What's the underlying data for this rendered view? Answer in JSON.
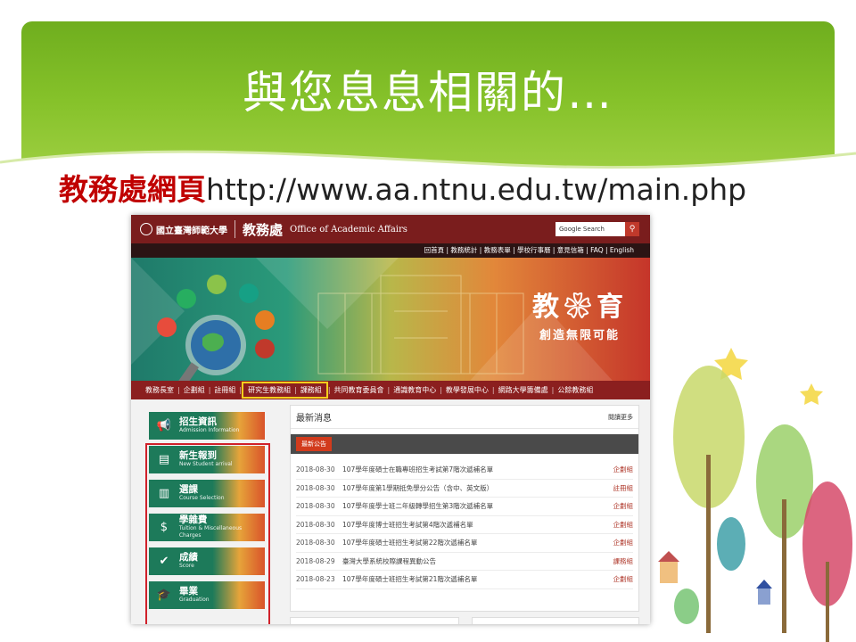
{
  "slide": {
    "title": "與您息息相關的…",
    "subtitle_red": "教務處網頁",
    "subtitle_url": "http://www.aa.ntnu.edu.tw/main.php"
  },
  "site": {
    "logo_text": "國立臺灣師範大學",
    "dept_zh": "教務處",
    "dept_en": "Office of Academic Affairs",
    "search_placeholder": "Google Search",
    "utility_links": "回首頁 | 教務統計 | 教務表單 | 學校行事曆 | 意見信箱 | FAQ | English",
    "hero_big": "教❀育",
    "hero_slogan": "創造無限可能",
    "nav": [
      "教務長室",
      "企劃組",
      "註冊組",
      "研究生教務組",
      "課務組",
      "共同教育委員會",
      "通識教育中心",
      "教學發展中心",
      "網路大學籌備處",
      "公餘教務組"
    ],
    "sidebar": [
      {
        "zh": "招生資訊",
        "en": "Admission Information",
        "icon": "megaphone-icon"
      },
      {
        "zh": "新生報到",
        "en": "New Student arrival",
        "icon": "document-icon"
      },
      {
        "zh": "選課",
        "en": "Course Selection",
        "icon": "book-icon"
      },
      {
        "zh": "學雜費",
        "en": "Tuition & Miscellaneous Charges",
        "icon": "dollar-icon"
      },
      {
        "zh": "成績",
        "en": "Score",
        "icon": "checklist-icon"
      },
      {
        "zh": "畢業",
        "en": "Graduation",
        "icon": "graduation-cap-icon"
      }
    ],
    "news": {
      "heading": "最新消息",
      "more": "閱讀更多",
      "tab": "最新公告",
      "rows": [
        {
          "date": "2018-08-30",
          "title": "107學年度碩士在職專班招生考試第7階次遞補名單",
          "unit": "企劃組"
        },
        {
          "date": "2018-08-30",
          "title": "107學年度第1學期抵免學分公告（含中、英文版）",
          "unit": "註冊組"
        },
        {
          "date": "2018-08-30",
          "title": "107學年度學士班二年級轉學招生第3階次遞補名單",
          "unit": "企劃組"
        },
        {
          "date": "2018-08-30",
          "title": "107學年度博士班招生考試第4階次遞補名單",
          "unit": "企劃組"
        },
        {
          "date": "2018-08-30",
          "title": "107學年度碩士班招生考試第22階次遞補名單",
          "unit": "企劃組"
        },
        {
          "date": "2018-08-29",
          "title": "臺灣大學系統校際課程異動公告",
          "unit": "課務組"
        },
        {
          "date": "2018-08-23",
          "title": "107學年度碩士班招生考試第21階次遞補名單",
          "unit": "企劃組"
        }
      ]
    }
  },
  "colors": {
    "banner": "#86c22a",
    "maroon": "#7a1d1d",
    "highlight": "#f3cf1c",
    "red_box": "#d0212a"
  }
}
